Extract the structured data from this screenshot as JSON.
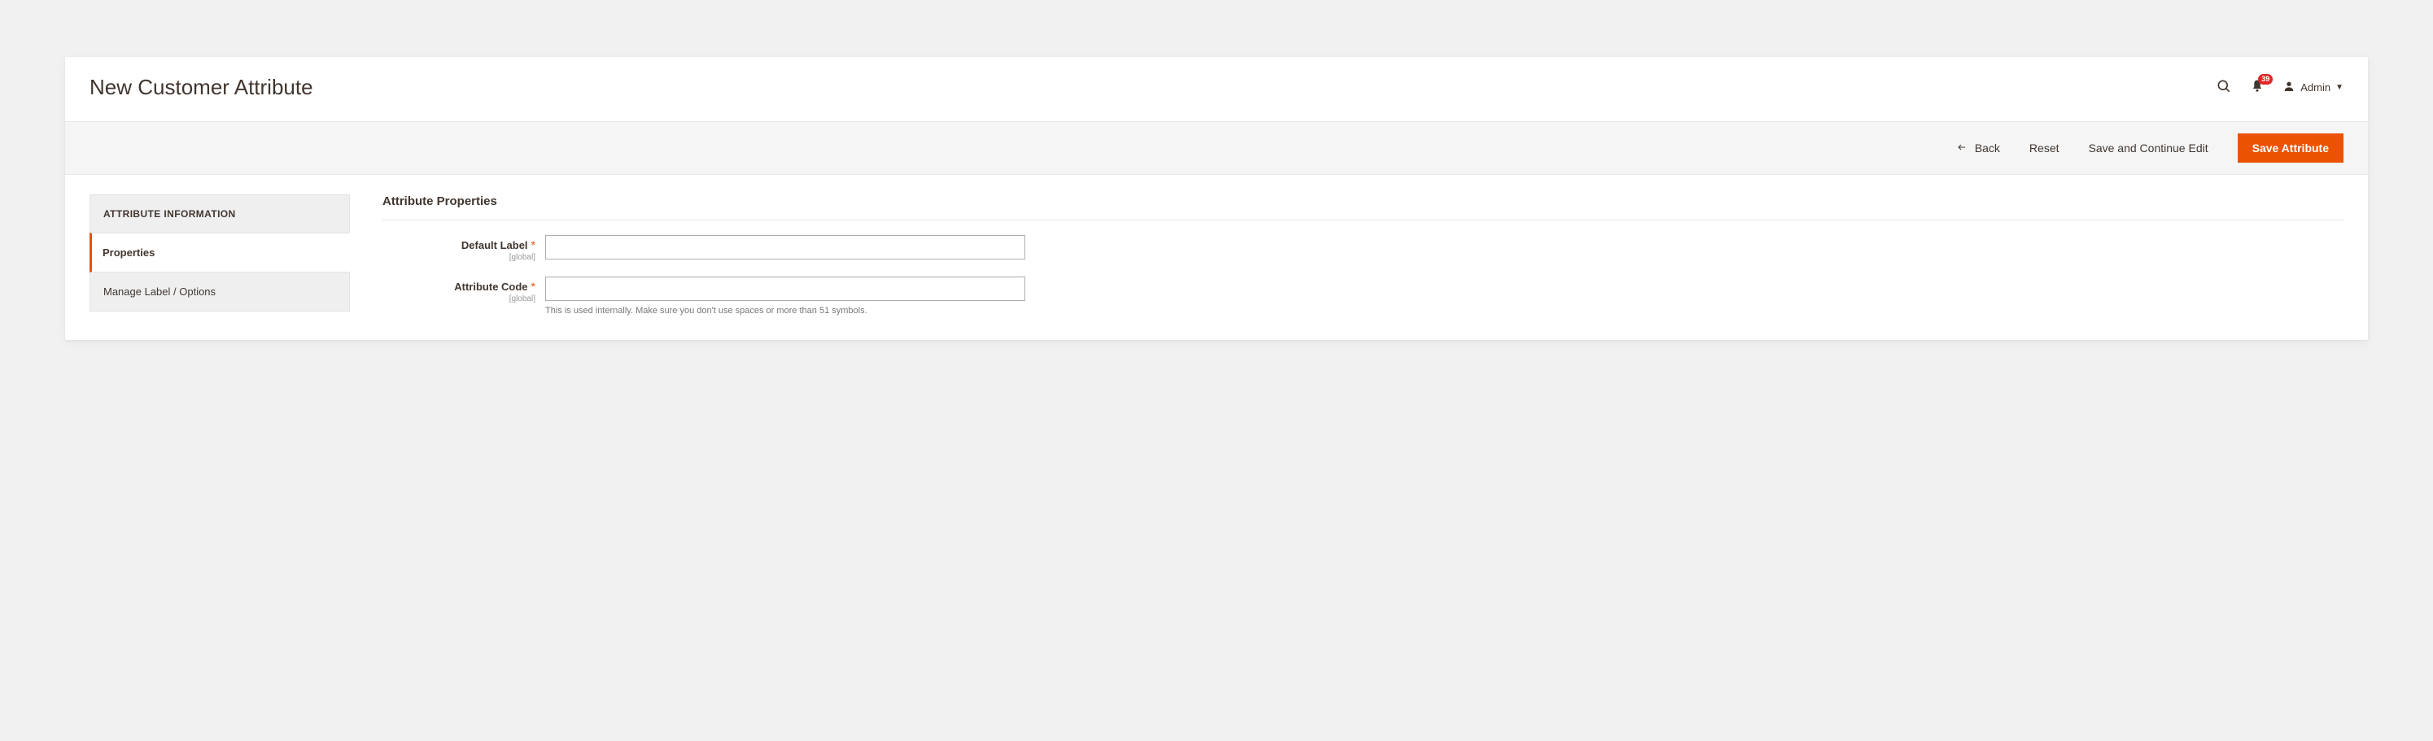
{
  "header": {
    "title": "New Customer Attribute",
    "notification_count": "39",
    "user_label": "Admin"
  },
  "actions": {
    "back": "Back",
    "reset": "Reset",
    "save_continue": "Save and Continue Edit",
    "save": "Save Attribute"
  },
  "sidebar": {
    "title": "ATTRIBUTE INFORMATION",
    "items": [
      {
        "label": "Properties",
        "active": true
      },
      {
        "label": "Manage Label / Options",
        "active": false
      }
    ]
  },
  "form": {
    "section_title": "Attribute Properties",
    "scope_text": "[global]",
    "required_mark": "*",
    "fields": {
      "default_label": {
        "label": "Default Label",
        "value": ""
      },
      "attribute_code": {
        "label": "Attribute Code",
        "value": "",
        "help": "This is used internally. Make sure you don't use spaces or more than 51 symbols."
      }
    }
  }
}
